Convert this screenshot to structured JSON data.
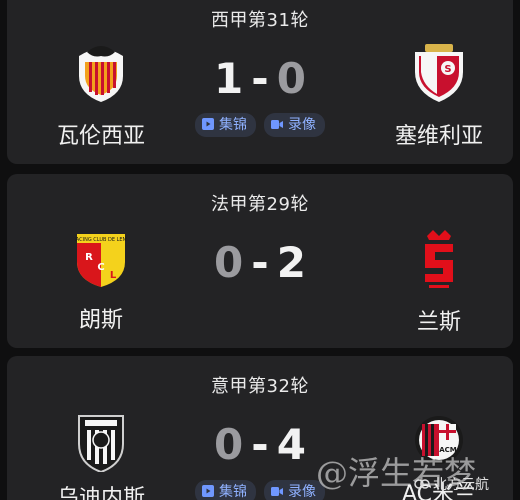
{
  "matches": [
    {
      "league": "西甲第31轮",
      "home": {
        "name": "瓦伦西亚",
        "crest_icon": "valencia-crest",
        "crest_color": "#f2a01c"
      },
      "away": {
        "name": "塞维利亚",
        "crest_icon": "sevilla-crest",
        "crest_color": "#c8102e"
      },
      "score": {
        "home": "1",
        "sep": "-",
        "away": "0"
      },
      "actions": [
        {
          "label": "集锦",
          "icon": "highlights-icon"
        },
        {
          "label": "录像",
          "icon": "replay-icon"
        }
      ]
    },
    {
      "league": "法甲第29轮",
      "home": {
        "name": "朗斯",
        "crest_icon": "lens-crest",
        "crest_color": "#d9161b"
      },
      "away": {
        "name": "兰斯",
        "crest_icon": "reims-crest",
        "crest_color": "#e10f1a"
      },
      "score": {
        "home": "0",
        "sep": "-",
        "away": "2"
      }
    },
    {
      "league": "意甲第32轮",
      "home": {
        "name": "乌迪内斯",
        "crest_icon": "udinese-crest",
        "crest_color": "#1a1a1a"
      },
      "away": {
        "name": "AC米兰",
        "crest_icon": "milan-crest",
        "crest_color": "#c8102e"
      },
      "score": {
        "home": "0",
        "sep": "-",
        "away": "4"
      },
      "actions": [
        {
          "label": "集锦",
          "icon": "highlights-icon"
        },
        {
          "label": "录像",
          "icon": "replay-icon"
        }
      ]
    }
  ],
  "watermark": "@浮生若梦",
  "source": "北方云航"
}
